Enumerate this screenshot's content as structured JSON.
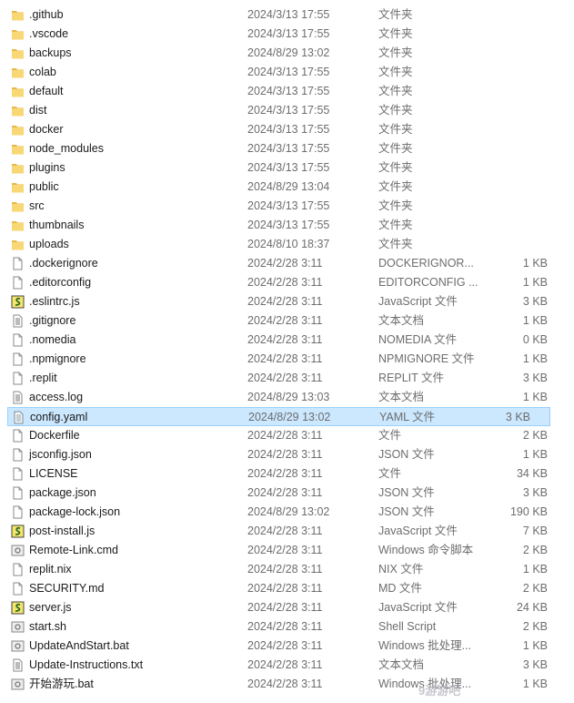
{
  "files": [
    {
      "name": ".github",
      "date": "2024/3/13 17:55",
      "type": "文件夹",
      "size": "",
      "icon": "folder-icon"
    },
    {
      "name": ".vscode",
      "date": "2024/3/13 17:55",
      "type": "文件夹",
      "size": "",
      "icon": "folder-icon"
    },
    {
      "name": "backups",
      "date": "2024/8/29 13:02",
      "type": "文件夹",
      "size": "",
      "icon": "folder-icon"
    },
    {
      "name": "colab",
      "date": "2024/3/13 17:55",
      "type": "文件夹",
      "size": "",
      "icon": "folder-icon"
    },
    {
      "name": "default",
      "date": "2024/3/13 17:55",
      "type": "文件夹",
      "size": "",
      "icon": "folder-icon"
    },
    {
      "name": "dist",
      "date": "2024/3/13 17:55",
      "type": "文件夹",
      "size": "",
      "icon": "folder-icon"
    },
    {
      "name": "docker",
      "date": "2024/3/13 17:55",
      "type": "文件夹",
      "size": "",
      "icon": "folder-icon"
    },
    {
      "name": "node_modules",
      "date": "2024/3/13 17:55",
      "type": "文件夹",
      "size": "",
      "icon": "folder-icon"
    },
    {
      "name": "plugins",
      "date": "2024/3/13 17:55",
      "type": "文件夹",
      "size": "",
      "icon": "folder-icon"
    },
    {
      "name": "public",
      "date": "2024/8/29 13:04",
      "type": "文件夹",
      "size": "",
      "icon": "folder-icon"
    },
    {
      "name": "src",
      "date": "2024/3/13 17:55",
      "type": "文件夹",
      "size": "",
      "icon": "folder-icon"
    },
    {
      "name": "thumbnails",
      "date": "2024/3/13 17:55",
      "type": "文件夹",
      "size": "",
      "icon": "folder-icon"
    },
    {
      "name": "uploads",
      "date": "2024/8/10 18:37",
      "type": "文件夹",
      "size": "",
      "icon": "folder-icon"
    },
    {
      "name": ".dockerignore",
      "date": "2024/2/28 3:11",
      "type": "DOCKERIGNOR...",
      "size": "1 KB",
      "icon": "blank-file-icon"
    },
    {
      "name": ".editorconfig",
      "date": "2024/2/28 3:11",
      "type": "EDITORCONFIG ...",
      "size": "1 KB",
      "icon": "blank-file-icon"
    },
    {
      "name": ".eslintrc.js",
      "date": "2024/2/28 3:11",
      "type": "JavaScript 文件",
      "size": "3 KB",
      "icon": "javascript-file-icon"
    },
    {
      "name": ".gitignore",
      "date": "2024/2/28 3:11",
      "type": "文本文档",
      "size": "1 KB",
      "icon": "text-file-icon"
    },
    {
      "name": ".nomedia",
      "date": "2024/2/28 3:11",
      "type": "NOMEDIA 文件",
      "size": "0 KB",
      "icon": "blank-file-icon"
    },
    {
      "name": ".npmignore",
      "date": "2024/2/28 3:11",
      "type": "NPMIGNORE 文件",
      "size": "1 KB",
      "icon": "blank-file-icon"
    },
    {
      "name": ".replit",
      "date": "2024/2/28 3:11",
      "type": "REPLIT 文件",
      "size": "3 KB",
      "icon": "blank-file-icon"
    },
    {
      "name": "access.log",
      "date": "2024/8/29 13:03",
      "type": "文本文档",
      "size": "1 KB",
      "icon": "text-file-icon"
    },
    {
      "name": "config.yaml",
      "date": "2024/8/29 13:02",
      "type": "YAML 文件",
      "size": "3 KB",
      "icon": "yaml-file-icon",
      "selected": true
    },
    {
      "name": "Dockerfile",
      "date": "2024/2/28 3:11",
      "type": "文件",
      "size": "2 KB",
      "icon": "blank-file-icon"
    },
    {
      "name": "jsconfig.json",
      "date": "2024/2/28 3:11",
      "type": "JSON 文件",
      "size": "1 KB",
      "icon": "blank-file-icon"
    },
    {
      "name": "LICENSE",
      "date": "2024/2/28 3:11",
      "type": "文件",
      "size": "34 KB",
      "icon": "blank-file-icon"
    },
    {
      "name": "package.json",
      "date": "2024/2/28 3:11",
      "type": "JSON 文件",
      "size": "3 KB",
      "icon": "blank-file-icon"
    },
    {
      "name": "package-lock.json",
      "date": "2024/8/29 13:02",
      "type": "JSON 文件",
      "size": "190 KB",
      "icon": "blank-file-icon"
    },
    {
      "name": "post-install.js",
      "date": "2024/2/28 3:11",
      "type": "JavaScript 文件",
      "size": "7 KB",
      "icon": "javascript-file-icon"
    },
    {
      "name": "Remote-Link.cmd",
      "date": "2024/2/28 3:11",
      "type": "Windows 命令脚本",
      "size": "2 KB",
      "icon": "batch-file-icon"
    },
    {
      "name": "replit.nix",
      "date": "2024/2/28 3:11",
      "type": "NIX 文件",
      "size": "1 KB",
      "icon": "blank-file-icon"
    },
    {
      "name": "SECURITY.md",
      "date": "2024/2/28 3:11",
      "type": "MD 文件",
      "size": "2 KB",
      "icon": "blank-file-icon"
    },
    {
      "name": "server.js",
      "date": "2024/2/28 3:11",
      "type": "JavaScript 文件",
      "size": "24 KB",
      "icon": "javascript-file-icon"
    },
    {
      "name": "start.sh",
      "date": "2024/2/28 3:11",
      "type": "Shell Script",
      "size": "2 KB",
      "icon": "batch-file-icon"
    },
    {
      "name": "UpdateAndStart.bat",
      "date": "2024/2/28 3:11",
      "type": "Windows 批处理...",
      "size": "1 KB",
      "icon": "batch-file-icon"
    },
    {
      "name": "Update-Instructions.txt",
      "date": "2024/2/28 3:11",
      "type": "文本文档",
      "size": "3 KB",
      "icon": "text-file-icon"
    },
    {
      "name": "开始游玩.bat",
      "date": "2024/2/28 3:11",
      "type": "Windows 批处理...",
      "size": "1 KB",
      "icon": "batch-file-icon"
    }
  ],
  "colors": {
    "selection_bg": "#cce8ff",
    "selection_border": "#99d1ff",
    "folder": "#f8d775"
  }
}
